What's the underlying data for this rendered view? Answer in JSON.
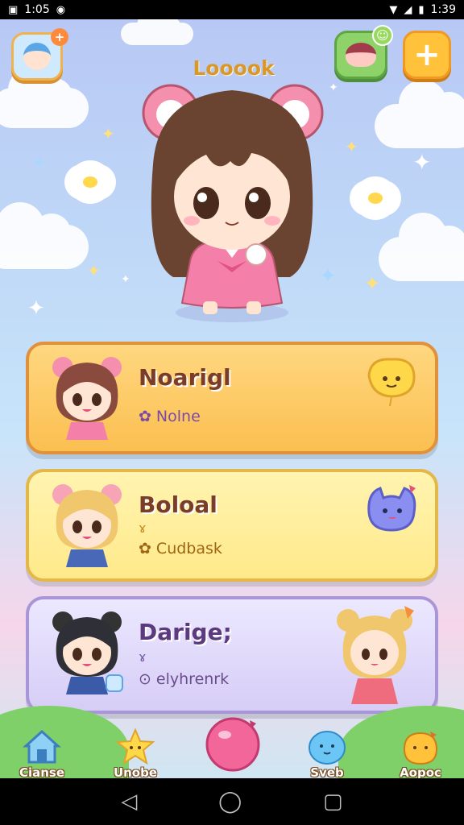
{
  "status_bar": {
    "time_left": "1:05",
    "time_right": "1:39",
    "icons": [
      "notification-icon",
      "sync-icon",
      "wifi-icon",
      "signal-icon",
      "battery-icon"
    ]
  },
  "header": {
    "title": "Looook",
    "avatar_badge": "+",
    "add_label": "+"
  },
  "cards": [
    {
      "name": "Noarigl",
      "tag_icon": "✿",
      "tag": "Nolne",
      "sub_icon": ""
    },
    {
      "name": "Boloal",
      "tag_icon": "✿",
      "tag": "Cudbask",
      "sub_icon": "ɤ"
    },
    {
      "name": "Darige;",
      "tag_icon": "⊙",
      "tag": "elyhrenrk",
      "sub_icon": "ɤ"
    }
  ],
  "bottom_nav": [
    {
      "label": "Cianse",
      "icon": "home-icon"
    },
    {
      "label": "Unobe",
      "icon": "star-icon"
    },
    {
      "label": "",
      "icon": "balloon-icon"
    },
    {
      "label": "Sveb",
      "icon": "blue-pet-icon"
    },
    {
      "label": "Aopoc",
      "icon": "yellow-pet-icon"
    }
  ],
  "android_nav": {
    "back": "◁",
    "home": "◯",
    "recents": "▢"
  },
  "colors": {
    "title": "#d9982c",
    "card_orange": "#fbbf50",
    "card_yellow": "#ffe98a",
    "card_lavender": "#d6cdf6"
  }
}
